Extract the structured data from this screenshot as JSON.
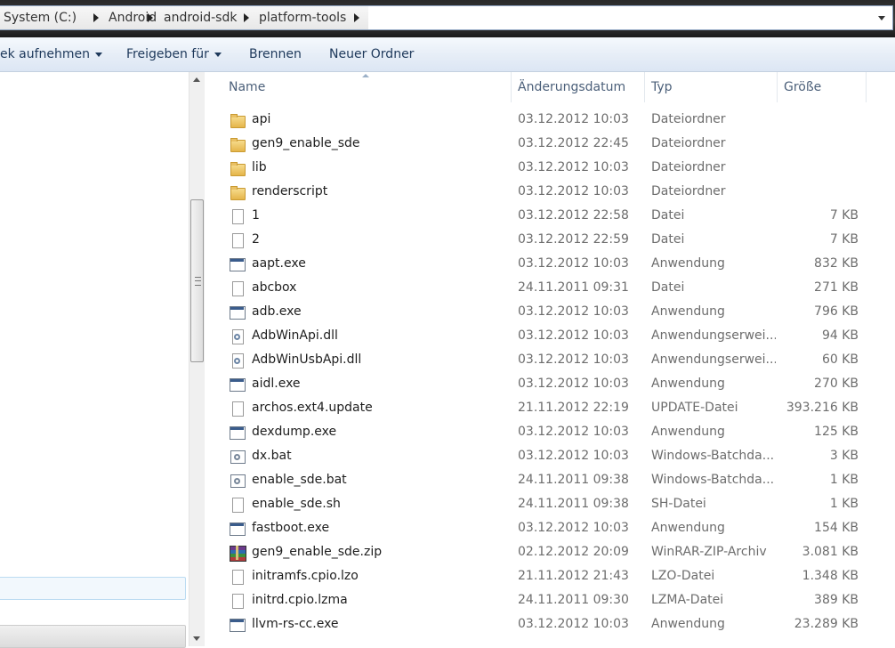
{
  "breadcrumb": {
    "items": [
      "System (C:)",
      "Android",
      "android-sdk",
      "platform-tools"
    ]
  },
  "toolbar": {
    "include_library_label": "ek aufnehmen",
    "share_label": "Freigeben für",
    "burn_label": "Brennen",
    "new_folder_label": "Neuer Ordner"
  },
  "columns": {
    "name": "Name",
    "date": "Änderungsdatum",
    "type": "Typ",
    "size": "Größe"
  },
  "files": [
    {
      "name": "api",
      "date": "03.12.2012 10:03",
      "type": "Dateiordner",
      "size": "",
      "icon": "folder-icon"
    },
    {
      "name": "gen9_enable_sde",
      "date": "03.12.2012 22:45",
      "type": "Dateiordner",
      "size": "",
      "icon": "folder-icon"
    },
    {
      "name": "lib",
      "date": "03.12.2012 10:03",
      "type": "Dateiordner",
      "size": "",
      "icon": "folder-icon"
    },
    {
      "name": "renderscript",
      "date": "03.12.2012 10:03",
      "type": "Dateiordner",
      "size": "",
      "icon": "folder-icon"
    },
    {
      "name": "1",
      "date": "03.12.2012 22:58",
      "type": "Datei",
      "size": "7 KB",
      "icon": "file-icon"
    },
    {
      "name": "2",
      "date": "03.12.2012 22:59",
      "type": "Datei",
      "size": "7 KB",
      "icon": "file-icon"
    },
    {
      "name": "aapt.exe",
      "date": "03.12.2012 10:03",
      "type": "Anwendung",
      "size": "832 KB",
      "icon": "exe-icon"
    },
    {
      "name": "abcbox",
      "date": "24.11.2011 09:31",
      "type": "Datei",
      "size": "271 KB",
      "icon": "file-icon"
    },
    {
      "name": "adb.exe",
      "date": "03.12.2012 10:03",
      "type": "Anwendung",
      "size": "796 KB",
      "icon": "exe-icon"
    },
    {
      "name": "AdbWinApi.dll",
      "date": "03.12.2012 10:03",
      "type": "Anwendungserwei...",
      "size": "94 KB",
      "icon": "dll-icon"
    },
    {
      "name": "AdbWinUsbApi.dll",
      "date": "03.12.2012 10:03",
      "type": "Anwendungserwei...",
      "size": "60 KB",
      "icon": "dll-icon"
    },
    {
      "name": "aidl.exe",
      "date": "03.12.2012 10:03",
      "type": "Anwendung",
      "size": "270 KB",
      "icon": "exe-icon"
    },
    {
      "name": "archos.ext4.update",
      "date": "21.11.2012 22:19",
      "type": "UPDATE-Datei",
      "size": "393.216 KB",
      "icon": "file-icon"
    },
    {
      "name": "dexdump.exe",
      "date": "03.12.2012 10:03",
      "type": "Anwendung",
      "size": "125 KB",
      "icon": "exe-icon"
    },
    {
      "name": "dx.bat",
      "date": "03.12.2012 10:03",
      "type": "Windows-Batchda...",
      "size": "3 KB",
      "icon": "bat-icon"
    },
    {
      "name": "enable_sde.bat",
      "date": "24.11.2011 09:38",
      "type": "Windows-Batchda...",
      "size": "1 KB",
      "icon": "bat-icon"
    },
    {
      "name": "enable_sde.sh",
      "date": "24.11.2011 09:38",
      "type": "SH-Datei",
      "size": "1 KB",
      "icon": "file-icon"
    },
    {
      "name": "fastboot.exe",
      "date": "03.12.2012 10:03",
      "type": "Anwendung",
      "size": "154 KB",
      "icon": "exe-icon"
    },
    {
      "name": "gen9_enable_sde.zip",
      "date": "02.12.2012 20:09",
      "type": "WinRAR-ZIP-Archiv",
      "size": "3.081 KB",
      "icon": "zip-icon"
    },
    {
      "name": "initramfs.cpio.lzo",
      "date": "21.11.2012 21:43",
      "type": "LZO-Datei",
      "size": "1.348 KB",
      "icon": "file-icon"
    },
    {
      "name": "initrd.cpio.lzma",
      "date": "24.11.2011 09:30",
      "type": "LZMA-Datei",
      "size": "389 KB",
      "icon": "file-icon"
    },
    {
      "name": "llvm-rs-cc.exe",
      "date": "03.12.2012 10:03",
      "type": "Anwendung",
      "size": "23.289 KB",
      "icon": "exe-icon"
    }
  ]
}
